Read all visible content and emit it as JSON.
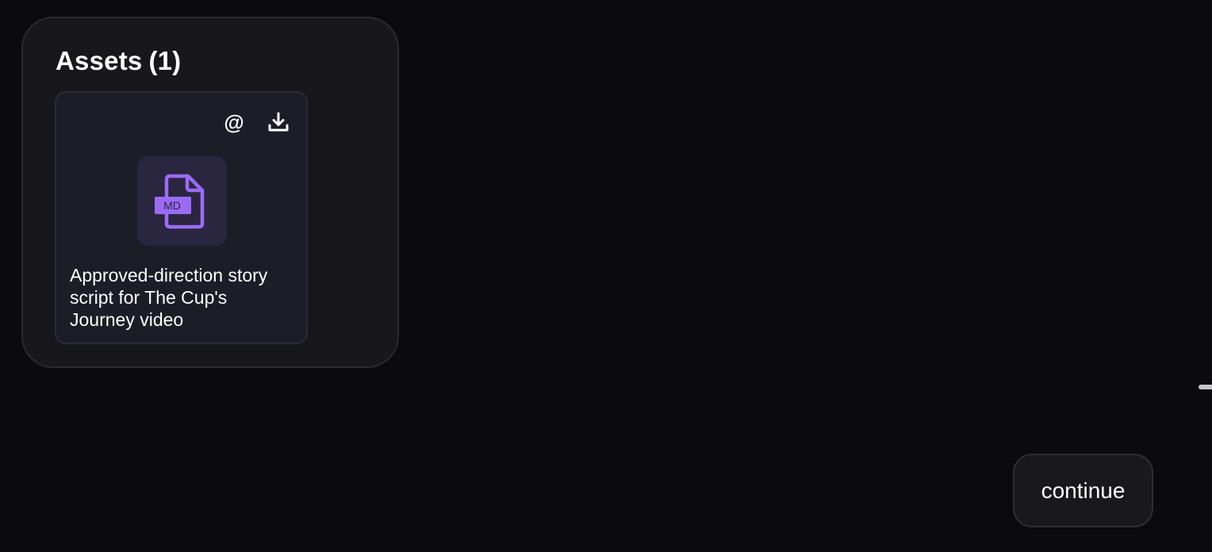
{
  "assets": {
    "title": "Assets",
    "count": "(1)",
    "items": [
      {
        "file_type": "MD",
        "description": "Approved-direction story script for The Cup's Journey video",
        "icon": "markdown-file-icon",
        "actions": [
          {
            "name": "mention",
            "label": "@",
            "icon": "at-icon"
          },
          {
            "name": "download",
            "icon": "download-icon"
          }
        ]
      }
    ]
  },
  "continue_button": {
    "label": "continue"
  },
  "colors": {
    "background": "#0b0a0f",
    "panel": "#17171c",
    "card": "#1c1d27",
    "accent": "#9b6bf5"
  }
}
